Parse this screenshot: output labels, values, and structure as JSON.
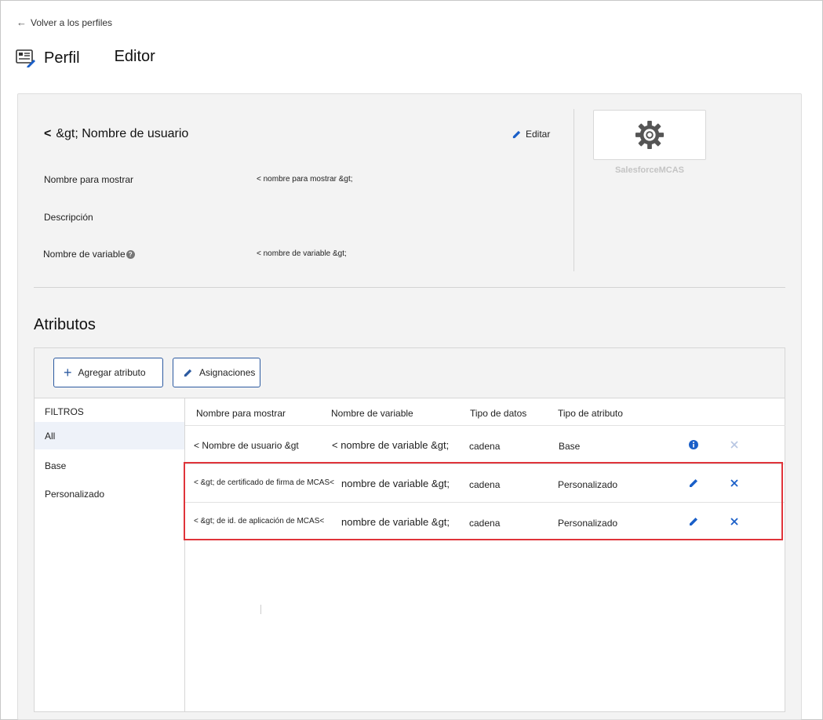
{
  "nav": {
    "back_label": "Volver a los perfiles",
    "back_arrow": "←"
  },
  "page": {
    "title_part1": "Perfil",
    "title_part2": "Editor",
    "icon": "profile-card-icon"
  },
  "profile": {
    "username_prefix": "<",
    "username": "&gt; Nombre de usuario",
    "edit_label": "Editar",
    "fields": [
      {
        "label": "Nombre para mostrar",
        "value": "< nombre para mostrar &gt;"
      },
      {
        "label": "Descripción",
        "value": ""
      },
      {
        "label": "Nombre de variable",
        "value": "< nombre de variable &gt;"
      }
    ],
    "help_glyph": "?",
    "app_name": "SalesforceMCAS",
    "app_icon": "gear-icon"
  },
  "attributes": {
    "section_title": "Atributos",
    "add_button": "Agregar atributo",
    "add_glyph": "+",
    "mappings_button": "Asignaciones",
    "filters": {
      "title": "FILTROS",
      "items": [
        "All",
        "Base",
        "Personalizado"
      ],
      "active": "All"
    },
    "columns": [
      "Nombre para mostrar",
      "Nombre de variable",
      "Tipo de datos",
      "Tipo de atributo"
    ],
    "rows": [
      {
        "display_name": "< Nombre de usuario &gt",
        "variable_name": "< nombre de variable &gt;",
        "data_type": "cadena",
        "attr_type": "Base",
        "action_icon": "info-icon",
        "delete_enabled": false
      },
      {
        "display_name": "< &gt; de certificado de firma de MCAS<",
        "variable_name": "nombre de variable &gt;",
        "data_type": "cadena",
        "attr_type": "Personalizado",
        "action_icon": "pencil-icon",
        "delete_enabled": true
      },
      {
        "display_name": "< &gt; de id. de aplicación de MCAS<",
        "variable_name": "nombre de variable &gt;",
        "data_type": "cadena",
        "attr_type": "Personalizado",
        "action_icon": "pencil-icon",
        "delete_enabled": true
      }
    ]
  },
  "colors": {
    "accent": "#2c5aa0",
    "highlight": "#e0343a",
    "icon_blue": "#1a5fc8"
  }
}
